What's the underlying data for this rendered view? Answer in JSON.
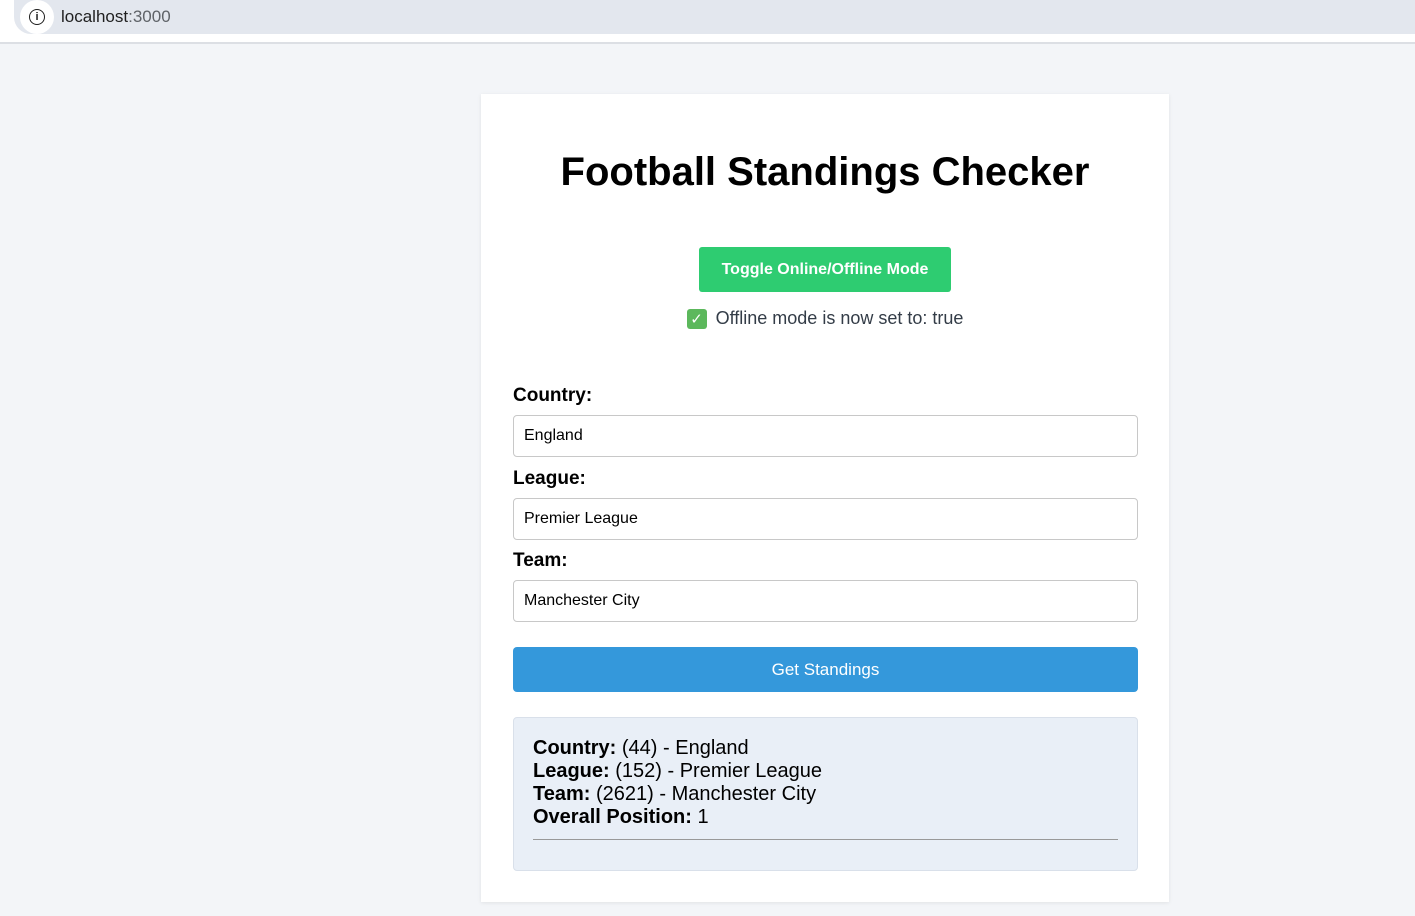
{
  "browser": {
    "url_host": "localhost",
    "url_port": ":3000"
  },
  "page": {
    "title": "Football Standings Checker",
    "toggle_button": "Toggle Online/Offline Mode",
    "status_message": "Offline mode is now set to: true",
    "status_icon": "check-box-icon",
    "accent_green": "#2ecc71",
    "accent_blue": "#3498db"
  },
  "form": {
    "country_label": "Country:",
    "country_value": "England",
    "league_label": "League:",
    "league_value": "Premier League",
    "team_label": "Team:",
    "team_value": "Manchester City",
    "submit_label": "Get Standings"
  },
  "results": {
    "country_label": "Country:",
    "country_value": "(44) - England",
    "league_label": "League:",
    "league_value": "(152) - Premier League",
    "team_label": "Team:",
    "team_value": "(2621) - Manchester City",
    "position_label": "Overall Position:",
    "position_value": "1"
  }
}
